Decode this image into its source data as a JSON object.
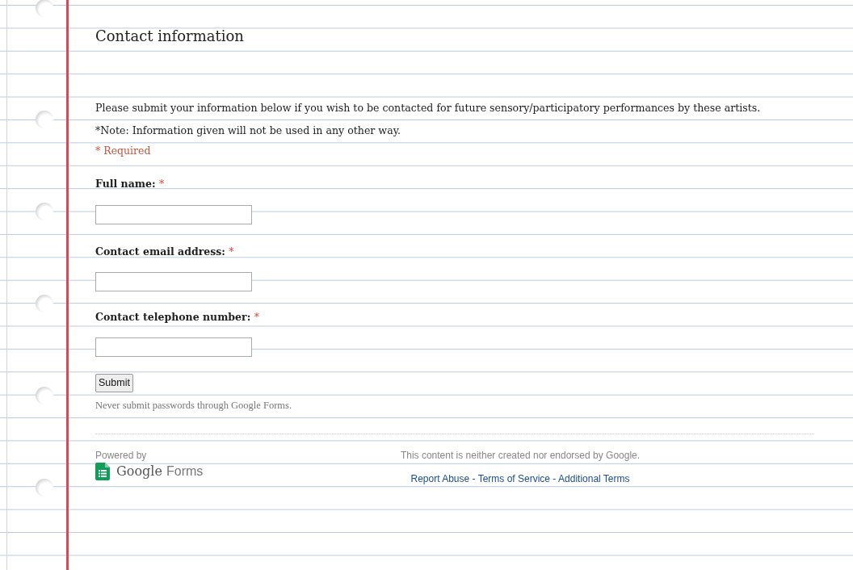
{
  "form": {
    "title": "Contact information",
    "description": "Please submit your information below if you wish to be contacted for future sensory/participatory performances by these artists.",
    "note": "*Note: Information given will not be used in any other way.",
    "required_note": "* Required",
    "required_marker": "*",
    "fields": [
      {
        "label": "Full name:",
        "required": true
      },
      {
        "label": "Contact email address:",
        "required": true
      },
      {
        "label": "Contact telephone number:",
        "required": true
      }
    ],
    "submit": "Submit",
    "warning": "Never submit passwords through Google Forms."
  },
  "footer": {
    "powered_by": "Powered by",
    "brand": "Google",
    "product": "Forms",
    "disclaimer": "This content is neither created nor endorsed by Google.",
    "links": [
      "Report Abuse",
      "Terms of Service",
      "Additional Terms"
    ],
    "link_separator": "-"
  }
}
